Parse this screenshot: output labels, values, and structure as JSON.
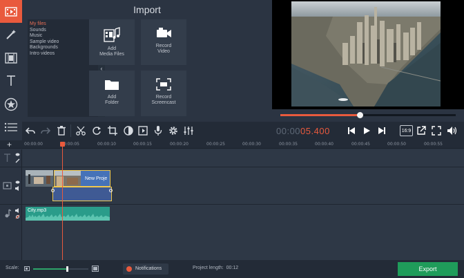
{
  "sidebar": {
    "tools": [
      "import-tool",
      "magic-wand-tool",
      "filters-tool",
      "titles-tool",
      "stickers-tool",
      "transitions-tool"
    ]
  },
  "import": {
    "title": "Import",
    "file_items": [
      "My files",
      "Sounds",
      "Music",
      "Sample video",
      "Backgrounds",
      "Intro videos"
    ],
    "tiles": [
      {
        "line1": "Add",
        "line2": "Media Files"
      },
      {
        "line1": "Record",
        "line2": "Video"
      },
      {
        "line1": "Add",
        "line2": "Folder"
      },
      {
        "line1": "Record",
        "line2": "Screencast"
      }
    ]
  },
  "preview": {
    "timecode_dim": "00:00",
    "timecode_hot": "05.400",
    "aspect_ratio": "16:9",
    "progress": 0.45
  },
  "ruler": {
    "ticks": [
      "00:00:00",
      "00:00:05",
      "00:00:10",
      "00:00:15",
      "00:00:20",
      "00:00:25",
      "00:00:30",
      "00:00:35",
      "00:00:40",
      "00:00:45",
      "00:00:50",
      "00:00:55"
    ]
  },
  "timeline": {
    "video_clip_label": "New Proje",
    "audio_clip_label": "City.mp3"
  },
  "bottom": {
    "scale_label": "Scale:",
    "notifications_label": "Notifications",
    "project_length_label": "Project length:",
    "project_length_value": "00:12",
    "export_label": "Export"
  },
  "colors": {
    "accent": "#e95a3d",
    "export": "#1f9c5a",
    "video_clip": "#4672b8",
    "audio_clip": "#2a9c8a"
  }
}
